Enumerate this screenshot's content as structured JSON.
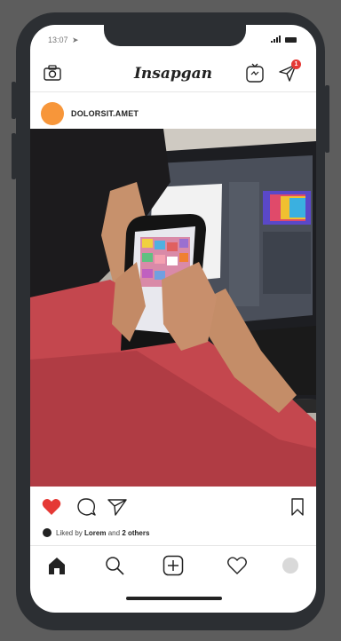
{
  "status": {
    "time": "13:07"
  },
  "header": {
    "brand": "Insapgan",
    "messages_badge": "1"
  },
  "post": {
    "username": "DOLORSIT.AMET",
    "liked_by_prefix": "Liked by",
    "liked_by_user": "Lorem",
    "liked_by_and": "and",
    "liked_by_others": "2 others"
  },
  "colors": {
    "like": "#e53935",
    "avatar": "#f7963a",
    "phone": "#2c2f33"
  },
  "icons": {
    "top": [
      "camera-icon",
      "tv-icon",
      "send-icon"
    ],
    "actions": [
      "heart-filled-icon",
      "comment-icon",
      "share-icon",
      "bookmark-icon"
    ],
    "nav": [
      "home-icon",
      "search-icon",
      "add-icon",
      "heart-icon",
      "profile-icon"
    ]
  }
}
